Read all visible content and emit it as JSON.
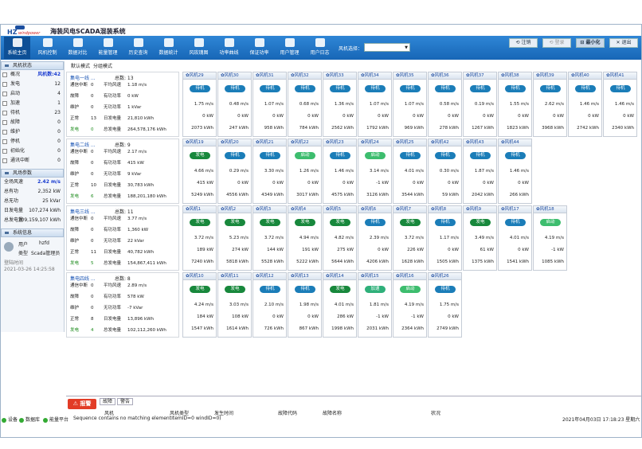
{
  "app": {
    "title": "海装风电SCADA混装系统",
    "logo_top": "HZ",
    "logo_bottom": "windpower"
  },
  "toolbar": {
    "buttons": [
      "系统主页",
      "风机控制",
      "数据对比",
      "能量管理",
      "历史查询",
      "数据统计",
      "风玫瑰图",
      "功率曲线",
      "保证功率",
      "用户管理",
      "用户日志"
    ],
    "fan_select_label": "风机选择：",
    "fan_select_value": "",
    "window": {
      "logout": "注销",
      "login": "登录",
      "minimize": "最小化",
      "exit": "退出"
    }
  },
  "sidebar": {
    "status_title": "风机状态",
    "status": [
      {
        "label": "概况",
        "value": "风机数:42",
        "blue": true
      },
      {
        "label": "发电",
        "value": "12"
      },
      {
        "label": "启动",
        "value": "4"
      },
      {
        "label": "加速",
        "value": "1"
      },
      {
        "label": "待机",
        "value": "23"
      },
      {
        "label": "故障",
        "value": "0"
      },
      {
        "label": "维护",
        "value": "0"
      },
      {
        "label": "停机",
        "value": "0"
      },
      {
        "label": "初始化",
        "value": "0"
      },
      {
        "label": "通讯中断",
        "value": "0"
      }
    ],
    "field_title": "风场参数",
    "field": [
      {
        "label": "全场风速",
        "value": "2.42 m/s",
        "blue": true
      },
      {
        "label": "总有功",
        "value": "2,352 kW"
      },
      {
        "label": "总无功",
        "value": "25 kVar"
      },
      {
        "label": "日发电量",
        "value": "107,274 kWh"
      },
      {
        "label": "总发电量",
        "value": "709,159,107 kWh"
      }
    ],
    "sys_title": "系统信息",
    "user_label": "用户",
    "user_value": "hzfd",
    "type_label": "类型",
    "type_value": "Scada管理员",
    "login_time_label": "登陆时间",
    "login_time_value": "2021-03-26 14:25:58"
  },
  "content": {
    "tabs": [
      "默认模式",
      "分组模式"
    ],
    "groups": [
      {
        "name": "集电一线 ...",
        "total": "13",
        "stats": [
          [
            "通信中断",
            "0",
            "平均风速",
            "1.18 m/s"
          ],
          [
            "故障",
            "0",
            "有功功率",
            "0 kW"
          ],
          [
            "维护",
            "0",
            "无功功率",
            "1 kVar"
          ],
          [
            "正常",
            "13",
            "日发电量",
            "21,810 kWh"
          ],
          [
            "发电",
            "0",
            "总发电量",
            "264,578,176 kWh"
          ]
        ]
      },
      {
        "name": "集电二线 ...",
        "total": "9",
        "stats": [
          [
            "通信中断",
            "0",
            "平均风速",
            "2.17 m/s"
          ],
          [
            "故障",
            "0",
            "有功功率",
            "415 kW"
          ],
          [
            "维护",
            "0",
            "无功功率",
            "9 kVar"
          ],
          [
            "正常",
            "10",
            "日发电量",
            "30,783 kWh"
          ],
          [
            "发电",
            "6",
            "总发电量",
            "188,201,180 kWh"
          ]
        ]
      },
      {
        "name": "集电三线 ...",
        "total": "11",
        "stats": [
          [
            "通信中断",
            "0",
            "平均风速",
            "3.77 m/s"
          ],
          [
            "故障",
            "0",
            "有功功率",
            "1,360 kW"
          ],
          [
            "维护",
            "0",
            "无功功率",
            "22 kVar"
          ],
          [
            "正常",
            "11",
            "日发电量",
            "40,782 kWh"
          ],
          [
            "发电",
            "5",
            "总发电量",
            "154,867,411 kWh"
          ]
        ]
      },
      {
        "name": "集电四线 ...",
        "total": "8",
        "stats": [
          [
            "通信中断",
            "0",
            "平均风速",
            "2.89 m/s"
          ],
          [
            "故障",
            "0",
            "有功功率",
            "578 kW"
          ],
          [
            "维护",
            "0",
            "无功功率",
            "-7 kVar"
          ],
          [
            "正常",
            "8",
            "日发电量",
            "13,896 kWh"
          ],
          [
            "发电",
            "4",
            "总发电量",
            "102,112,260 kWh"
          ]
        ]
      }
    ],
    "rows": [
      [
        {
          "n": "风机29",
          "s": "待机",
          "c": "wait",
          "w": "1.75 m/s",
          "p": "0 kW",
          "e": "2073 kWh"
        },
        {
          "n": "风机30",
          "s": "待机",
          "c": "wait",
          "w": "0.48 m/s",
          "p": "0 kW",
          "e": "247 kWh"
        },
        {
          "n": "风机31",
          "s": "待机",
          "c": "wait",
          "w": "1.07 m/s",
          "p": "0 kW",
          "e": "958 kWh"
        },
        {
          "n": "风机32",
          "s": "待机",
          "c": "wait",
          "w": "0.68 m/s",
          "p": "0 kW",
          "e": "784 kWh"
        },
        {
          "n": "风机33",
          "s": "待机",
          "c": "wait",
          "w": "1.36 m/s",
          "p": "0 kW",
          "e": "2562 kWh"
        },
        {
          "n": "风机34",
          "s": "待机",
          "c": "wait",
          "w": "1.07 m/s",
          "p": "0 kW",
          "e": "1792 kWh"
        },
        {
          "n": "风机35",
          "s": "待机",
          "c": "wait",
          "w": "1.07 m/s",
          "p": "0 kW",
          "e": "969 kWh"
        },
        {
          "n": "风机36",
          "s": "待机",
          "c": "wait",
          "w": "0.58 m/s",
          "p": "0 kW",
          "e": "278 kWh"
        },
        {
          "n": "风机37",
          "s": "待机",
          "c": "wait",
          "w": "0.19 m/s",
          "p": "0 kW",
          "e": "1267 kWh"
        },
        {
          "n": "风机38",
          "s": "待机",
          "c": "wait",
          "w": "1.55 m/s",
          "p": "0 kW",
          "e": "1823 kWh"
        },
        {
          "n": "风机39",
          "s": "待机",
          "c": "wait",
          "w": "2.62 m/s",
          "p": "0 kW",
          "e": "3968 kWh"
        },
        {
          "n": "风机40",
          "s": "待机",
          "c": "wait",
          "w": "1.46 m/s",
          "p": "0 kW",
          "e": "2742 kWh"
        },
        {
          "n": "风机41",
          "s": "待机",
          "c": "wait",
          "w": "1.46 m/s",
          "p": "0 kW",
          "e": "2340 kWh"
        }
      ],
      [
        {
          "n": "风机19",
          "s": "发电",
          "c": "gen",
          "w": "4.66 m/s",
          "p": "415 kW",
          "e": "5249 kWh"
        },
        {
          "n": "风机20",
          "s": "待机",
          "c": "wait",
          "w": "0.29 m/s",
          "p": "0 kW",
          "e": "4556 kWh"
        },
        {
          "n": "风机21",
          "s": "待机",
          "c": "wait",
          "w": "3.30 m/s",
          "p": "0 kW",
          "e": "4349 kWh"
        },
        {
          "n": "风机22",
          "s": "启动",
          "c": "start",
          "w": "1.26 m/s",
          "p": "0 kW",
          "e": "3017 kWh"
        },
        {
          "n": "风机23",
          "s": "待机",
          "c": "wait",
          "w": "1.46 m/s",
          "p": "0 kW",
          "e": "4575 kWh"
        },
        {
          "n": "风机24",
          "s": "启动",
          "c": "start",
          "w": "3.14 m/s",
          "p": "-1 kW",
          "e": "3126 kWh"
        },
        {
          "n": "风机25",
          "s": "待机",
          "c": "wait",
          "w": "4.01 m/s",
          "p": "0 kW",
          "e": "3544 kWh"
        },
        {
          "n": "风机42",
          "s": "待机",
          "c": "wait",
          "w": "0.30 m/s",
          "p": "0 kW",
          "e": "59 kWh"
        },
        {
          "n": "风机43",
          "s": "待机",
          "c": "wait",
          "w": "1.87 m/s",
          "p": "0 kW",
          "e": "2042 kWh"
        },
        {
          "n": "风机44",
          "s": "待机",
          "c": "wait",
          "w": "1.46 m/s",
          "p": "0 kW",
          "e": "266 kWh"
        }
      ],
      [
        {
          "n": "风机1",
          "s": "发电",
          "c": "gen",
          "w": "3.72 m/s",
          "p": "189 kW",
          "e": "7240 kWh"
        },
        {
          "n": "风机2",
          "s": "发电",
          "c": "gen",
          "w": "5.23 m/s",
          "p": "274 kW",
          "e": "5818 kWh"
        },
        {
          "n": "风机3",
          "s": "发电",
          "c": "gen",
          "w": "3.72 m/s",
          "p": "144 kW",
          "e": "5528 kWh"
        },
        {
          "n": "风机4",
          "s": "发电",
          "c": "gen",
          "w": "4.94 m/s",
          "p": "191 kW",
          "e": "5222 kWh"
        },
        {
          "n": "风机5",
          "s": "发电",
          "c": "gen",
          "w": "4.82 m/s",
          "p": "275 kW",
          "e": "5644 kWh"
        },
        {
          "n": "风机6",
          "s": "待机",
          "c": "wait",
          "w": "2.39 m/s",
          "p": "0 kW",
          "e": "4206 kWh"
        },
        {
          "n": "风机7",
          "s": "发电",
          "c": "gen",
          "w": "3.72 m/s",
          "p": "226 kW",
          "e": "1628 kWh"
        },
        {
          "n": "风机8",
          "s": "待机",
          "c": "wait",
          "w": "1.17 m/s",
          "p": "0 kW",
          "e": "1505 kWh"
        },
        {
          "n": "风机9",
          "s": "发电",
          "c": "gen",
          "w": "3.49 m/s",
          "p": "61 kW",
          "e": "1375 kWh"
        },
        {
          "n": "风机17",
          "s": "待机",
          "c": "wait",
          "w": "4.01 m/s",
          "p": "0 kW",
          "e": "1541 kWh"
        },
        {
          "n": "风机18",
          "s": "启动",
          "c": "start",
          "w": "4.19 m/s",
          "p": "-1 kW",
          "e": "1085 kWh"
        }
      ],
      [
        {
          "n": "风机10",
          "s": "发电",
          "c": "gen",
          "w": "4.24 m/s",
          "p": "184 kW",
          "e": "1547 kWh"
        },
        {
          "n": "风机11",
          "s": "发电",
          "c": "gen",
          "w": "3.03 m/s",
          "p": "108 kW",
          "e": "1614 kWh"
        },
        {
          "n": "风机12",
          "s": "待机",
          "c": "wait",
          "w": "2.10 m/s",
          "p": "0 kW",
          "e": "726 kWh"
        },
        {
          "n": "风机13",
          "s": "待机",
          "c": "wait",
          "w": "1.98 m/s",
          "p": "0 kW",
          "e": "867 kWh"
        },
        {
          "n": "风机14",
          "s": "发电",
          "c": "gen",
          "w": "4.01 m/s",
          "p": "286 kW",
          "e": "1998 kWh"
        },
        {
          "n": "风机15",
          "s": "加速",
          "c": "accel",
          "w": "1.81 m/s",
          "p": "-1 kW",
          "e": "2031 kWh"
        },
        {
          "n": "风机16",
          "s": "启动",
          "c": "start",
          "w": "4.19 m/s",
          "p": "-1 kW",
          "e": "2364 kWh"
        },
        {
          "n": "风机26",
          "s": "待机",
          "c": "wait",
          "w": "1.75 m/s",
          "p": "0 kW",
          "e": "2749 kWh"
        }
      ]
    ],
    "label_total": "总数:"
  },
  "alarm": {
    "button": "报警",
    "tabs": [
      "故障",
      "警告"
    ],
    "columns": [
      "风机",
      "风机类型",
      "发生时间",
      "故障代码",
      "故障名称",
      "状况"
    ]
  },
  "statusbar": {
    "items": [
      "设备",
      "数据库",
      "能量平台"
    ],
    "message": "Sequence contains no matching elementItemID=0 windID=0)",
    "datetime": "2021年04月03日 17:18:23 星期六"
  }
}
